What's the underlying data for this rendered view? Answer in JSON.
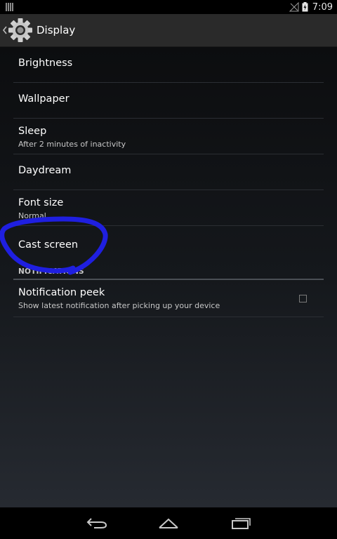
{
  "status_bar": {
    "time": "7:09",
    "icons": [
      "notification-icon",
      "no-signal-icon",
      "battery-charging-icon"
    ]
  },
  "action_bar": {
    "title": "Display",
    "icons": [
      "up-chevron-icon",
      "settings-gear-icon"
    ]
  },
  "settings": {
    "items": [
      {
        "title": "Brightness"
      },
      {
        "title": "Wallpaper"
      },
      {
        "title": "Sleep",
        "summary": "After 2 minutes of inactivity"
      },
      {
        "title": "Daydream"
      },
      {
        "title": "Font size",
        "summary": "Normal"
      },
      {
        "title": "Cast screen"
      }
    ],
    "section_header": "NOTIFICATIONS",
    "notification_peek": {
      "title": "Notification peek",
      "summary": "Show latest notification after picking up your device",
      "checked": false
    }
  },
  "nav_bar": {
    "buttons": [
      "back-icon",
      "home-icon",
      "recents-icon"
    ]
  },
  "colors": {
    "action_bar": "#2a2a2a",
    "annotation_stroke": "#1f1fe0",
    "divider": "#2b2e33"
  }
}
